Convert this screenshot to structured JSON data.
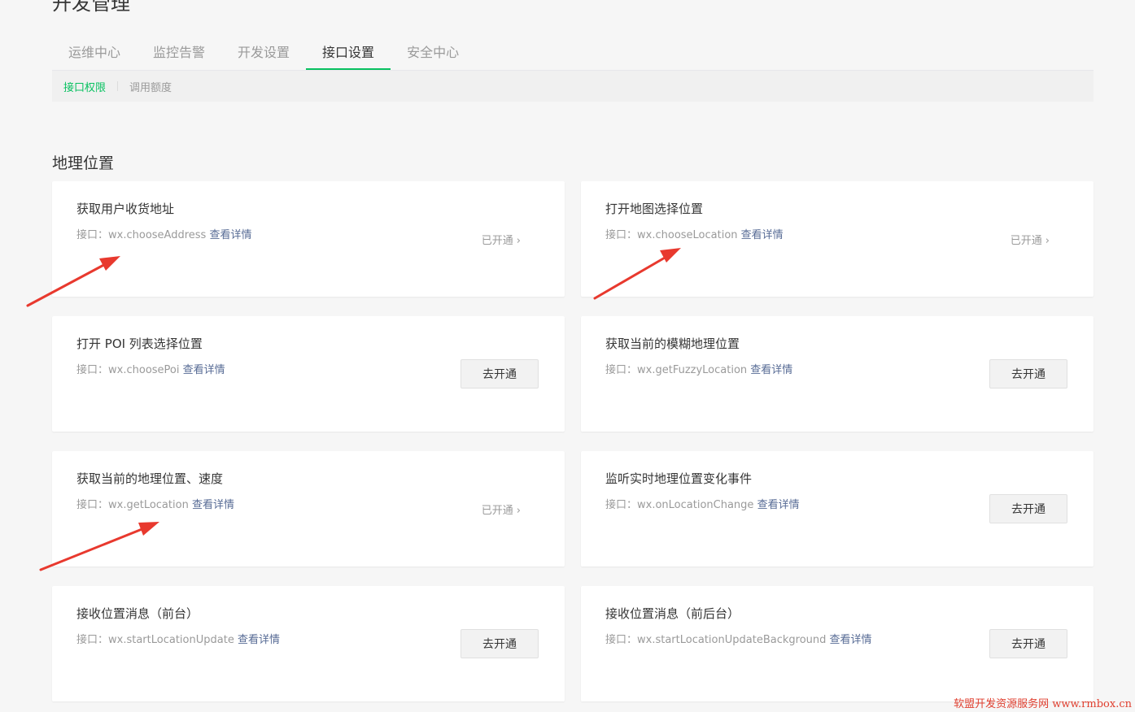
{
  "page": {
    "title": "开发管理"
  },
  "tabs": [
    {
      "label": "运维中心",
      "active": false
    },
    {
      "label": "监控告警",
      "active": false
    },
    {
      "label": "开发设置",
      "active": false
    },
    {
      "label": "接口设置",
      "active": true
    },
    {
      "label": "安全中心",
      "active": false
    }
  ],
  "subtabs": [
    {
      "label": "接口权限",
      "active": true
    },
    {
      "label": "调用额度",
      "active": false
    }
  ],
  "section": {
    "title": "地理位置"
  },
  "cards": [
    {
      "title": "获取用户收货地址",
      "api_prefix": "接口：",
      "api": "wx.chooseAddress",
      "detail": "查看详情",
      "state": "opened",
      "status_label": "已开通"
    },
    {
      "title": "打开地图选择位置",
      "api_prefix": "接口：",
      "api": "wx.chooseLocation",
      "detail": "查看详情",
      "state": "opened",
      "status_label": "已开通"
    },
    {
      "title": "打开 POI 列表选择位置",
      "api_prefix": "接口：",
      "api": "wx.choosePoi",
      "detail": "查看详情",
      "state": "closed",
      "button_label": "去开通"
    },
    {
      "title": "获取当前的模糊地理位置",
      "api_prefix": "接口：",
      "api": "wx.getFuzzyLocation",
      "detail": "查看详情",
      "state": "closed",
      "button_label": "去开通"
    },
    {
      "title": "获取当前的地理位置、速度",
      "api_prefix": "接口：",
      "api": "wx.getLocation",
      "detail": "查看详情",
      "state": "opened",
      "status_label": "已开通"
    },
    {
      "title": "监听实时地理位置变化事件",
      "api_prefix": "接口：",
      "api": "wx.onLocationChange",
      "detail": "查看详情",
      "state": "closed",
      "button_label": "去开通"
    },
    {
      "title": "接收位置消息（前台）",
      "api_prefix": "接口：",
      "api": "wx.startLocationUpdate",
      "detail": "查看详情",
      "state": "closed",
      "button_label": "去开通"
    },
    {
      "title": "接收位置消息（前后台）",
      "api_prefix": "接口：",
      "api": "wx.startLocationUpdateBackground",
      "detail": "查看详情",
      "state": "closed",
      "button_label": "去开通"
    }
  ],
  "colors": {
    "accent": "#07c160",
    "link": "#576b95",
    "annotation": "#e8392e"
  },
  "watermark": "软盟开发资源服务网 www.rmbox.cn"
}
